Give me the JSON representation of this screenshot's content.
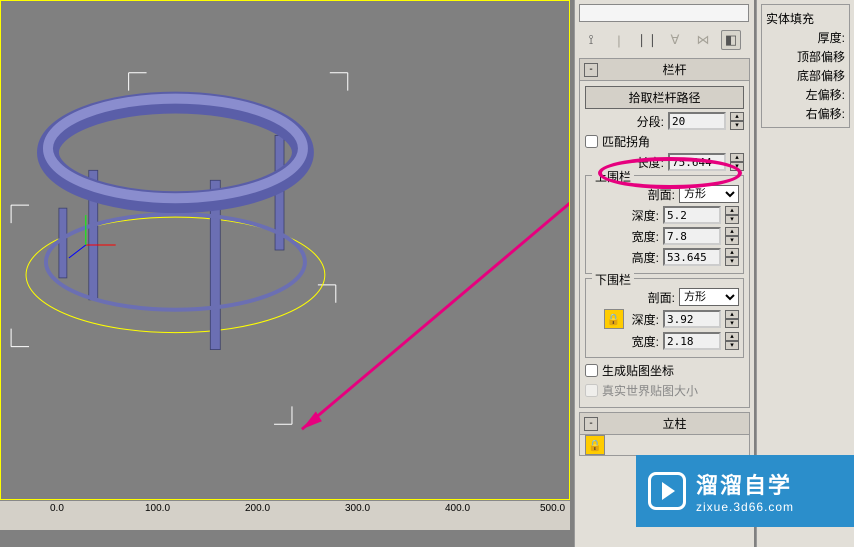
{
  "rollouts": {
    "railing": {
      "title": "栏杆",
      "pick_path": "拾取栏杆路径",
      "segment_label": "分段:",
      "segment_value": "20",
      "match_corners": "匹配拐角",
      "length_label": "长度:",
      "length_value": "75.644"
    },
    "upper_rail": {
      "title": "上围栏",
      "profile_label": "剖面:",
      "profile_value": "方形",
      "depth_label": "深度:",
      "depth_value": "5.2",
      "width_label": "宽度:",
      "width_value": "7.8",
      "height_label": "高度:",
      "height_value": "53.645"
    },
    "lower_rail": {
      "title": "下围栏",
      "profile_label": "剖面:",
      "profile_value": "方形",
      "depth_label": "深度:",
      "depth_value": "3.92",
      "width_label": "宽度:",
      "width_value": "2.18"
    },
    "generate_uvs": "生成贴图坐标",
    "real_world_map": "真实世界贴图大小",
    "post": {
      "title": "立柱"
    }
  },
  "far_right": {
    "solid_fill": "实体填充",
    "thickness": "厚度:",
    "top_offset": "顶部偏移",
    "bottom_offset": "底部偏移",
    "left_offset": "左偏移:",
    "right_offset": "右偏移:"
  },
  "ruler": {
    "v0": "0.0",
    "v100": "100.0",
    "v200": "200.0",
    "v300": "300.0",
    "v400": "400.0",
    "v500": "500.0"
  },
  "watermark": {
    "cn": "溜溜自学",
    "url": "zixue.3d66.com"
  }
}
